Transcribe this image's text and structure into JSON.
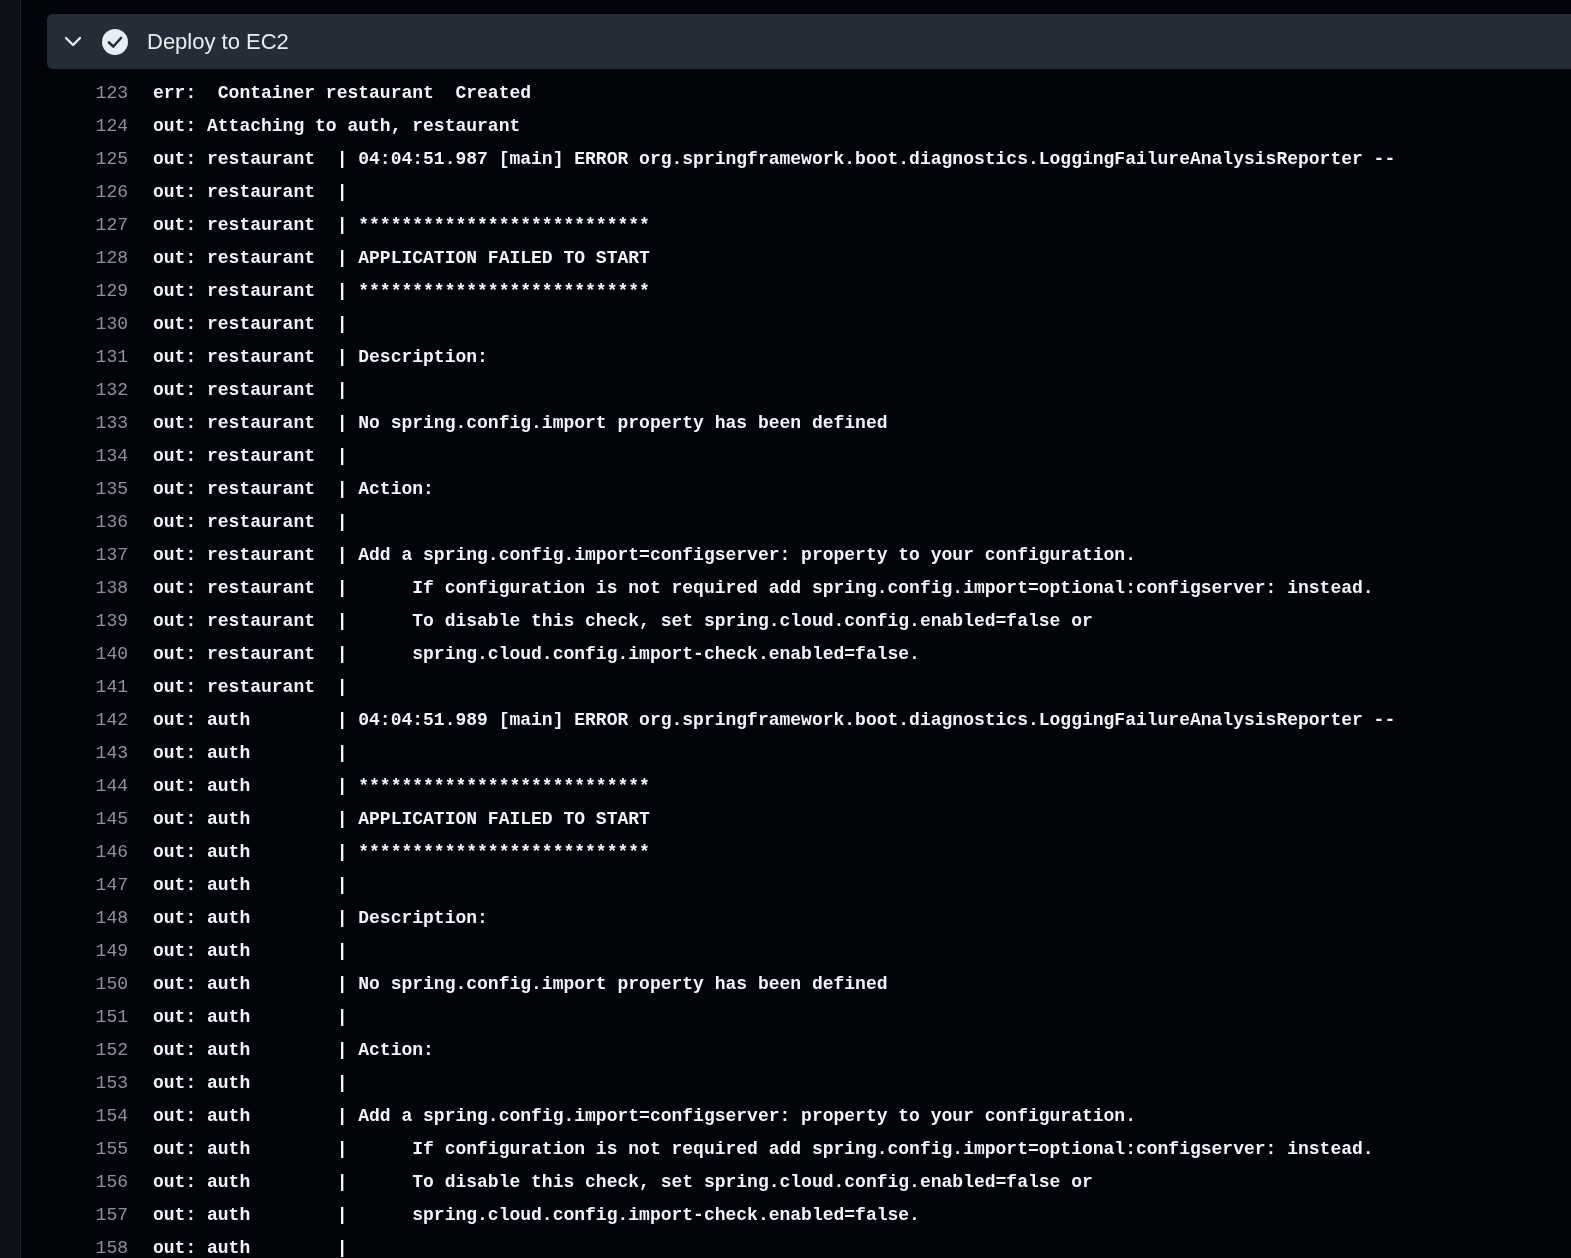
{
  "step": {
    "title": "Deploy to EC2",
    "expanded": true,
    "passed": true
  },
  "lines": [
    {
      "number": "123",
      "text": "err:  Container restaurant  Created"
    },
    {
      "number": "124",
      "text": "out: Attaching to auth, restaurant"
    },
    {
      "number": "125",
      "text": "out: restaurant  | 04:04:51.987 [main] ERROR org.springframework.boot.diagnostics.LoggingFailureAnalysisReporter --"
    },
    {
      "number": "126",
      "text": "out: restaurant  |"
    },
    {
      "number": "127",
      "text": "out: restaurant  | ***************************"
    },
    {
      "number": "128",
      "text": "out: restaurant  | APPLICATION FAILED TO START"
    },
    {
      "number": "129",
      "text": "out: restaurant  | ***************************"
    },
    {
      "number": "130",
      "text": "out: restaurant  |"
    },
    {
      "number": "131",
      "text": "out: restaurant  | Description:"
    },
    {
      "number": "132",
      "text": "out: restaurant  |"
    },
    {
      "number": "133",
      "text": "out: restaurant  | No spring.config.import property has been defined"
    },
    {
      "number": "134",
      "text": "out: restaurant  |"
    },
    {
      "number": "135",
      "text": "out: restaurant  | Action:"
    },
    {
      "number": "136",
      "text": "out: restaurant  |"
    },
    {
      "number": "137",
      "text": "out: restaurant  | Add a spring.config.import=configserver: property to your configuration."
    },
    {
      "number": "138",
      "text": "out: restaurant  |      If configuration is not required add spring.config.import=optional:configserver: instead."
    },
    {
      "number": "139",
      "text": "out: restaurant  |      To disable this check, set spring.cloud.config.enabled=false or"
    },
    {
      "number": "140",
      "text": "out: restaurant  |      spring.cloud.config.import-check.enabled=false."
    },
    {
      "number": "141",
      "text": "out: restaurant  |"
    },
    {
      "number": "142",
      "text": "out: auth        | 04:04:51.989 [main] ERROR org.springframework.boot.diagnostics.LoggingFailureAnalysisReporter --"
    },
    {
      "number": "143",
      "text": "out: auth        |"
    },
    {
      "number": "144",
      "text": "out: auth        | ***************************"
    },
    {
      "number": "145",
      "text": "out: auth        | APPLICATION FAILED TO START"
    },
    {
      "number": "146",
      "text": "out: auth        | ***************************"
    },
    {
      "number": "147",
      "text": "out: auth        |"
    },
    {
      "number": "148",
      "text": "out: auth        | Description:"
    },
    {
      "number": "149",
      "text": "out: auth        |"
    },
    {
      "number": "150",
      "text": "out: auth        | No spring.config.import property has been defined"
    },
    {
      "number": "151",
      "text": "out: auth        |"
    },
    {
      "number": "152",
      "text": "out: auth        | Action:"
    },
    {
      "number": "153",
      "text": "out: auth        |"
    },
    {
      "number": "154",
      "text": "out: auth        | Add a spring.config.import=configserver: property to your configuration."
    },
    {
      "number": "155",
      "text": "out: auth        |      If configuration is not required add spring.config.import=optional:configserver: instead."
    },
    {
      "number": "156",
      "text": "out: auth        |      To disable this check, set spring.cloud.config.enabled=false or"
    },
    {
      "number": "157",
      "text": "out: auth        |      spring.cloud.config.import-check.enabled=false."
    },
    {
      "number": "158",
      "text": "out: auth        |"
    }
  ]
}
